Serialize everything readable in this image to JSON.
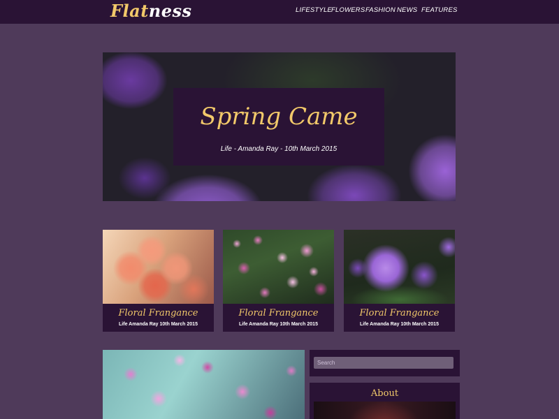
{
  "header": {
    "logo_part1": "Flat",
    "logo_part2": "ness",
    "nav": [
      "LIFESTYLE",
      "FLOWERS",
      "FASHION",
      "NEWS",
      "FEATURES"
    ]
  },
  "hero": {
    "title": "Spring Came",
    "meta": "Life - Amanda Ray - 10th March 2015"
  },
  "cards": [
    {
      "title": "Floral Frangance",
      "meta": "Life Amanda Ray 10th March 2015"
    },
    {
      "title": "Floral Frangance",
      "meta": "Life Amanda Ray 10th March 2015"
    },
    {
      "title": "Floral Frangance",
      "meta": "Life Amanda Ray 10th March 2015"
    }
  ],
  "sidebar": {
    "search_placeholder": "Search",
    "about_title": "About"
  },
  "colors": {
    "page_bg": "#4f3a5a",
    "panel_bg": "#2a1335",
    "accent": "#f2c96a"
  }
}
